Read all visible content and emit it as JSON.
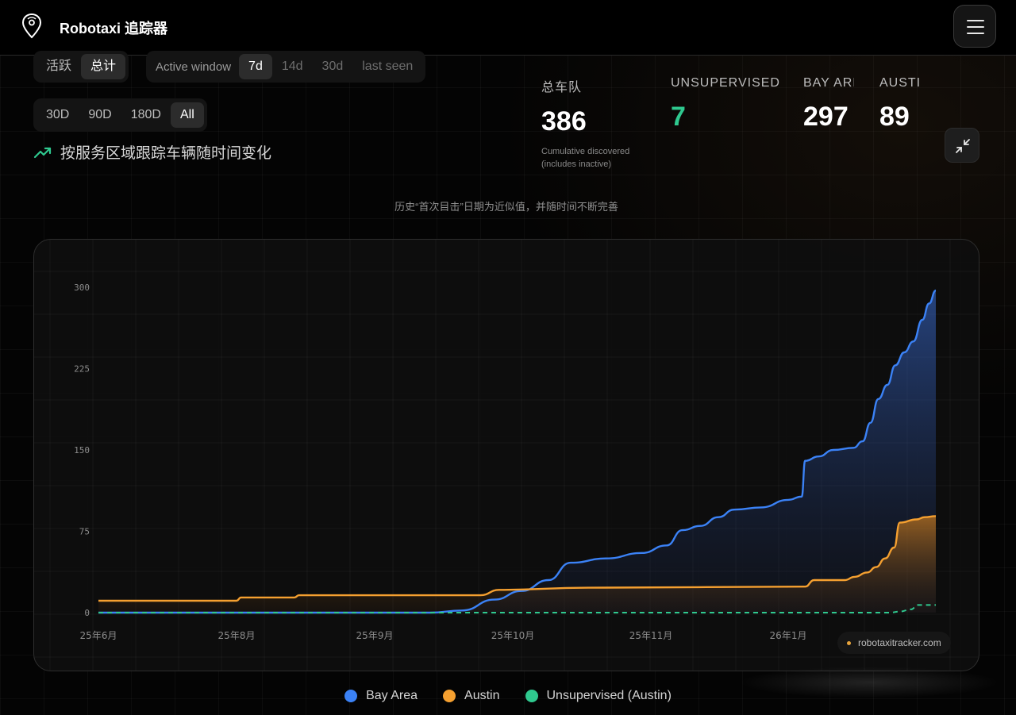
{
  "header": {
    "brand": "Robotaxi 追踪器",
    "menu_icon": "hamburger-icon",
    "logo_icon": "map-pin-icon"
  },
  "filters": {
    "status": [
      {
        "label": "活跃",
        "active": false
      },
      {
        "label": "总计",
        "active": true
      }
    ],
    "window_label": "Active window",
    "window": [
      {
        "label": "7d",
        "active": true
      },
      {
        "label": "14d",
        "active": false
      },
      {
        "label": "30d",
        "active": false
      },
      {
        "label": "last seen",
        "active": false
      }
    ],
    "range": [
      {
        "label": "30D",
        "active": false
      },
      {
        "label": "90D",
        "active": false
      },
      {
        "label": "180D",
        "active": false
      },
      {
        "label": "All",
        "active": true
      }
    ]
  },
  "subtitle": "按服务区域跟踪车辆随时间变化",
  "stats": [
    {
      "label": "总车队",
      "value": "386",
      "note": "Cumulative discovered (includes inactive)"
    },
    {
      "label": "UNSUPERVISED",
      "value": "7"
    },
    {
      "label": "BAY AREA",
      "value": "297"
    },
    {
      "label": "AUSTIN",
      "value": "89"
    }
  ],
  "note": "历史“首次目击”日期为近似值，并随时间不断完善",
  "watermark": "robotaxitracker.com",
  "colors": {
    "bay_area": "#3b82f6",
    "austin": "#f5a030",
    "unsupervised": "#2fc98f",
    "background": "#040404"
  },
  "legend": [
    {
      "label": "Bay Area",
      "color": "#3b82f6"
    },
    {
      "label": "Austin",
      "color": "#f5a030"
    },
    {
      "label": "Unsupervised (Austin)",
      "color": "#2fc98f"
    }
  ],
  "chart_data": {
    "type": "area",
    "x_ticks": [
      "25年6月",
      "25年8月",
      "25年9月",
      "25年10月",
      "25年11月",
      "26年1月"
    ],
    "x_tick_dates": [
      "2025-06-22",
      "2025-08-01",
      "2025-09-01",
      "2025-10-01",
      "2025-11-01",
      "2026-01-01"
    ],
    "y_ticks": [
      "0",
      "75",
      "150",
      "225",
      "300"
    ],
    "ylim": [
      0,
      300
    ],
    "xlim": [
      "2025-06-22",
      "2026-02-03"
    ],
    "grid": true,
    "legend_position": "bottom-center",
    "series": [
      {
        "name": "Bay Area",
        "style": "solid-area",
        "points": [
          [
            "2025-06-22",
            0
          ],
          [
            "2025-09-13",
            0
          ],
          [
            "2025-09-20",
            2
          ],
          [
            "2025-09-27",
            12
          ],
          [
            "2025-10-03",
            20
          ],
          [
            "2025-10-09",
            30
          ],
          [
            "2025-10-14",
            46
          ],
          [
            "2025-10-22",
            50
          ],
          [
            "2025-10-30",
            55
          ],
          [
            "2025-11-08",
            62
          ],
          [
            "2025-11-15",
            76
          ],
          [
            "2025-11-23",
            80
          ],
          [
            "2025-12-01",
            88
          ],
          [
            "2025-12-08",
            95
          ],
          [
            "2025-12-20",
            97
          ],
          [
            "2026-01-01",
            104
          ],
          [
            "2026-01-13",
            107
          ],
          [
            "2026-01-16",
            140
          ],
          [
            "2026-01-28",
            144
          ],
          [
            "2026-02-10",
            150
          ],
          [
            "2026-02-28",
            152
          ],
          [
            "2026-03-08",
            158
          ],
          [
            "2026-03-15",
            175
          ],
          [
            "2026-03-22",
            197
          ],
          [
            "2026-03-30",
            210
          ],
          [
            "2026-04-06",
            228
          ],
          [
            "2026-04-14",
            240
          ],
          [
            "2026-04-22",
            250
          ],
          [
            "2026-04-30",
            270
          ],
          [
            "2026-05-06",
            285
          ],
          [
            "2026-05-12",
            297
          ]
        ]
      },
      {
        "name": "Austin",
        "style": "solid-area",
        "points": [
          [
            "2025-06-22",
            11
          ],
          [
            "2025-08-01",
            11
          ],
          [
            "2025-08-02",
            14
          ],
          [
            "2025-08-14",
            14
          ],
          [
            "2025-08-15",
            16
          ],
          [
            "2025-09-24",
            16
          ],
          [
            "2025-09-28",
            21
          ],
          [
            "2025-10-18",
            23
          ],
          [
            "2026-01-16",
            24
          ],
          [
            "2026-01-24",
            30
          ],
          [
            "2026-02-20",
            30
          ],
          [
            "2026-03-01",
            33
          ],
          [
            "2026-03-12",
            37
          ],
          [
            "2026-03-20",
            42
          ],
          [
            "2026-03-28",
            50
          ],
          [
            "2026-04-05",
            60
          ],
          [
            "2026-04-10",
            83
          ],
          [
            "2026-04-25",
            86
          ],
          [
            "2026-05-02",
            88
          ],
          [
            "2026-05-12",
            89
          ]
        ]
      },
      {
        "name": "Unsupervised (Austin)",
        "style": "dashed",
        "points": [
          [
            "2025-06-22",
            0
          ],
          [
            "2026-04-01",
            0
          ],
          [
            "2026-04-10",
            1
          ],
          [
            "2026-04-20",
            3
          ],
          [
            "2026-04-26",
            7
          ],
          [
            "2026-05-12",
            7
          ]
        ]
      }
    ]
  }
}
